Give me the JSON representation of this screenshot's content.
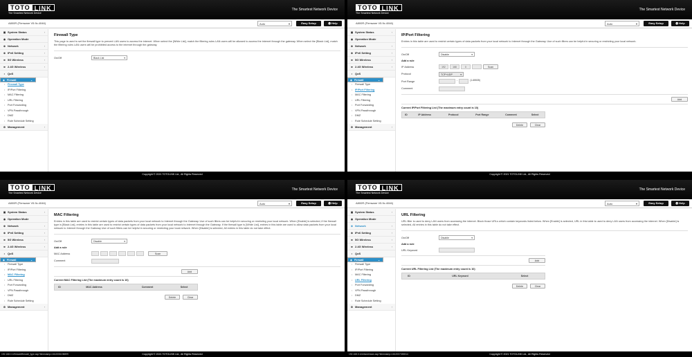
{
  "header": {
    "logo_primary": "TOTO",
    "logo_secondary": "LINK",
    "logo_sub": "The Smartest Network Device",
    "tagline": "The Smartest Network Device"
  },
  "topbar": {
    "model": "A800R (Firmware V5.9c.4046)",
    "language": "Auto",
    "easy_setup": "Easy Setup",
    "help": "Help"
  },
  "icons": {
    "help": "help-icon",
    "dropdown": "chevron-down-icon"
  },
  "accent_color": "#2a8fc9",
  "footer": {
    "copyright": "Copyright © 2021 TOTOLINK Ltd., All Rights Reserved"
  },
  "menu": {
    "system_status": "System Status",
    "operation_mode": "Operation Mode",
    "network": "Network",
    "ipv6": "IPv6 Setting",
    "w5g": "5G Wireless",
    "w24g": "2.4G Wireless",
    "qos": "QoS",
    "firewall": "Firewall",
    "management": "Management",
    "firewall_items": [
      "Firewall Type",
      "IP/Port Filtering",
      "MAC Filtering",
      "URL Filtering",
      "Port Forwarding",
      "VPN Passthrough",
      "DMZ",
      "Rule Schedule Setting"
    ]
  },
  "p0": {
    "title": "Firewall Type",
    "desc": "This page is used to set the firewall type to prevent LAN users to access the internet. When select the [White List], match the filtering rules LAN users will be allowed to access the internet through the gateway. When select the [Black List], match the filtering rules LAN users will be prohibited access to the internet through the gateway.",
    "onoff_label": "On/Off",
    "onoff_value": "Black List"
  },
  "p1": {
    "title": "IP/Port Filtering",
    "desc": "Entries in this table are used to restrict certain types of data packets from your local network to Internet through the Gateway. Use of such filters can be helpful in securing or restricting your local network.",
    "onoff_label": "On/Off",
    "onoff_value": "Disable",
    "add_rule": "Add a rule",
    "ip_label": "IP Address",
    "ip": [
      "192",
      "168",
      "0",
      ""
    ],
    "scan": "Scan",
    "protocol_label": "Protocol",
    "protocol_value": "TCP+UDP",
    "port_label": "Port Range",
    "port_hint": "(1-65535)",
    "comment_label": "Comment",
    "add_btn": "Add",
    "table_title": "Current IP/Port Filtering List (The maximum entry count is 10)",
    "cols": [
      "ID",
      "IP Address",
      "Protocol",
      "Port Range",
      "Comment",
      "Select"
    ],
    "delete": "Delete",
    "clear": "Clear"
  },
  "p2": {
    "title": "MAC Filtering",
    "desc": "Entries in this table are used to restrict certain types of data packets from your local network to Internet through the Gateway. Use of such filters can be helpful in securing or restricting your local network. When [Enable] is selected, if the firewall type is [Black List], entries in this table are used to restrict certain types of data packets from your local network to Internet through the Gateway. If the firewall type is [White List], entries in this table are used to allow data packets from your local network to Internet through the Gateway Use of such filters can be helpful in securing or restricting your local network. When [Disable] is selected, All entries in this table do not take effect.",
    "onoff_label": "On/Off",
    "onoff_value": "Disable",
    "add_rule": "Add a rule",
    "mac_label": "MAC Address",
    "scan": "Scan",
    "comment_label": "Comment",
    "add_btn": "Add",
    "table_title": "Current MAC Filtering List (The maximum entry count is 10)",
    "cols": [
      "ID",
      "MAC Address",
      "Comment",
      "Select"
    ],
    "delete": "Delete",
    "clear": "Clear",
    "url": "192.168.0.1/firewall/firewall_type.asp?timestamp=1612006198899"
  },
  "p3": {
    "title": "URL Filtering",
    "desc": "URL filter is used to deny LAN users from accessing the internet. Block those URLs which contain keywords listed below. When [Enable] is selected, URL in this table is used to deny LAN users from accessing the internet. When [Disable] is selected, All entries in this table do not take effect.",
    "onoff_label": "On/Off",
    "onoff_value": "Disable",
    "add_rule": "Add a rule",
    "keyword_label": "URL Keyword",
    "add_btn": "Add",
    "table_title": "Current URL Filtering List (The maximum entry count is 10)",
    "cols": [
      "ID",
      "URL Keyword",
      "Select"
    ],
    "delete": "Delete",
    "clear": "Clear",
    "url": "192.168.0.1/network/wan.asp?timestamp=1612007353514"
  }
}
